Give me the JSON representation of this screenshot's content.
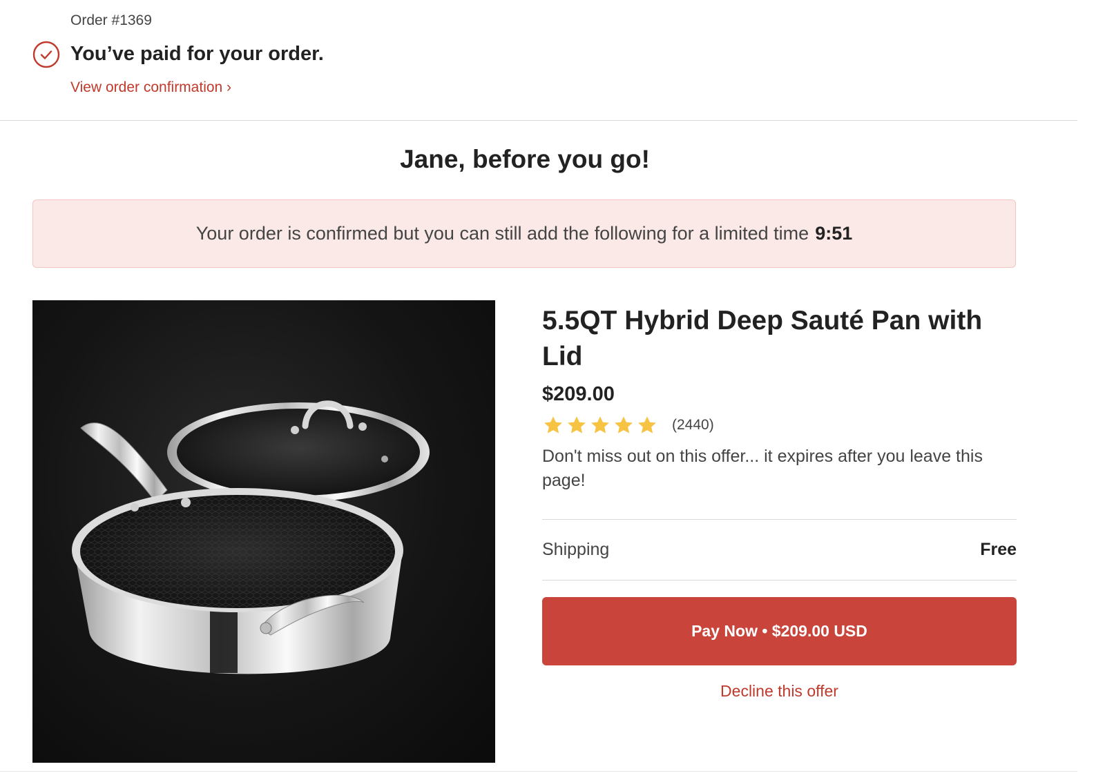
{
  "order": {
    "number_label": "Order #1369",
    "status_title": "You’ve paid for your order.",
    "confirmation_link": "View order confirmation ›"
  },
  "headline": "Jane, before you go!",
  "banner": {
    "text": "Your order is confirmed but you can still add the following for a limited time",
    "timer": "9:51"
  },
  "product": {
    "title": "5.5QT Hybrid Deep Sauté Pan with Lid",
    "price": "$209.00",
    "rating_stars": 5,
    "review_count": "(2440)",
    "offer_note": "Don't miss out on this offer... it expires after you leave this page!",
    "shipping_label": "Shipping",
    "shipping_value": "Free",
    "pay_button_label": "Pay Now • $209.00 USD",
    "decline_label": "Decline this offer"
  },
  "colors": {
    "accent": "#c9443a",
    "link": "#c0392b",
    "banner_bg": "#fbe9e7",
    "star": "#f6c343"
  },
  "icons": {
    "status": "check-circle-icon",
    "rating": "star-icon"
  }
}
